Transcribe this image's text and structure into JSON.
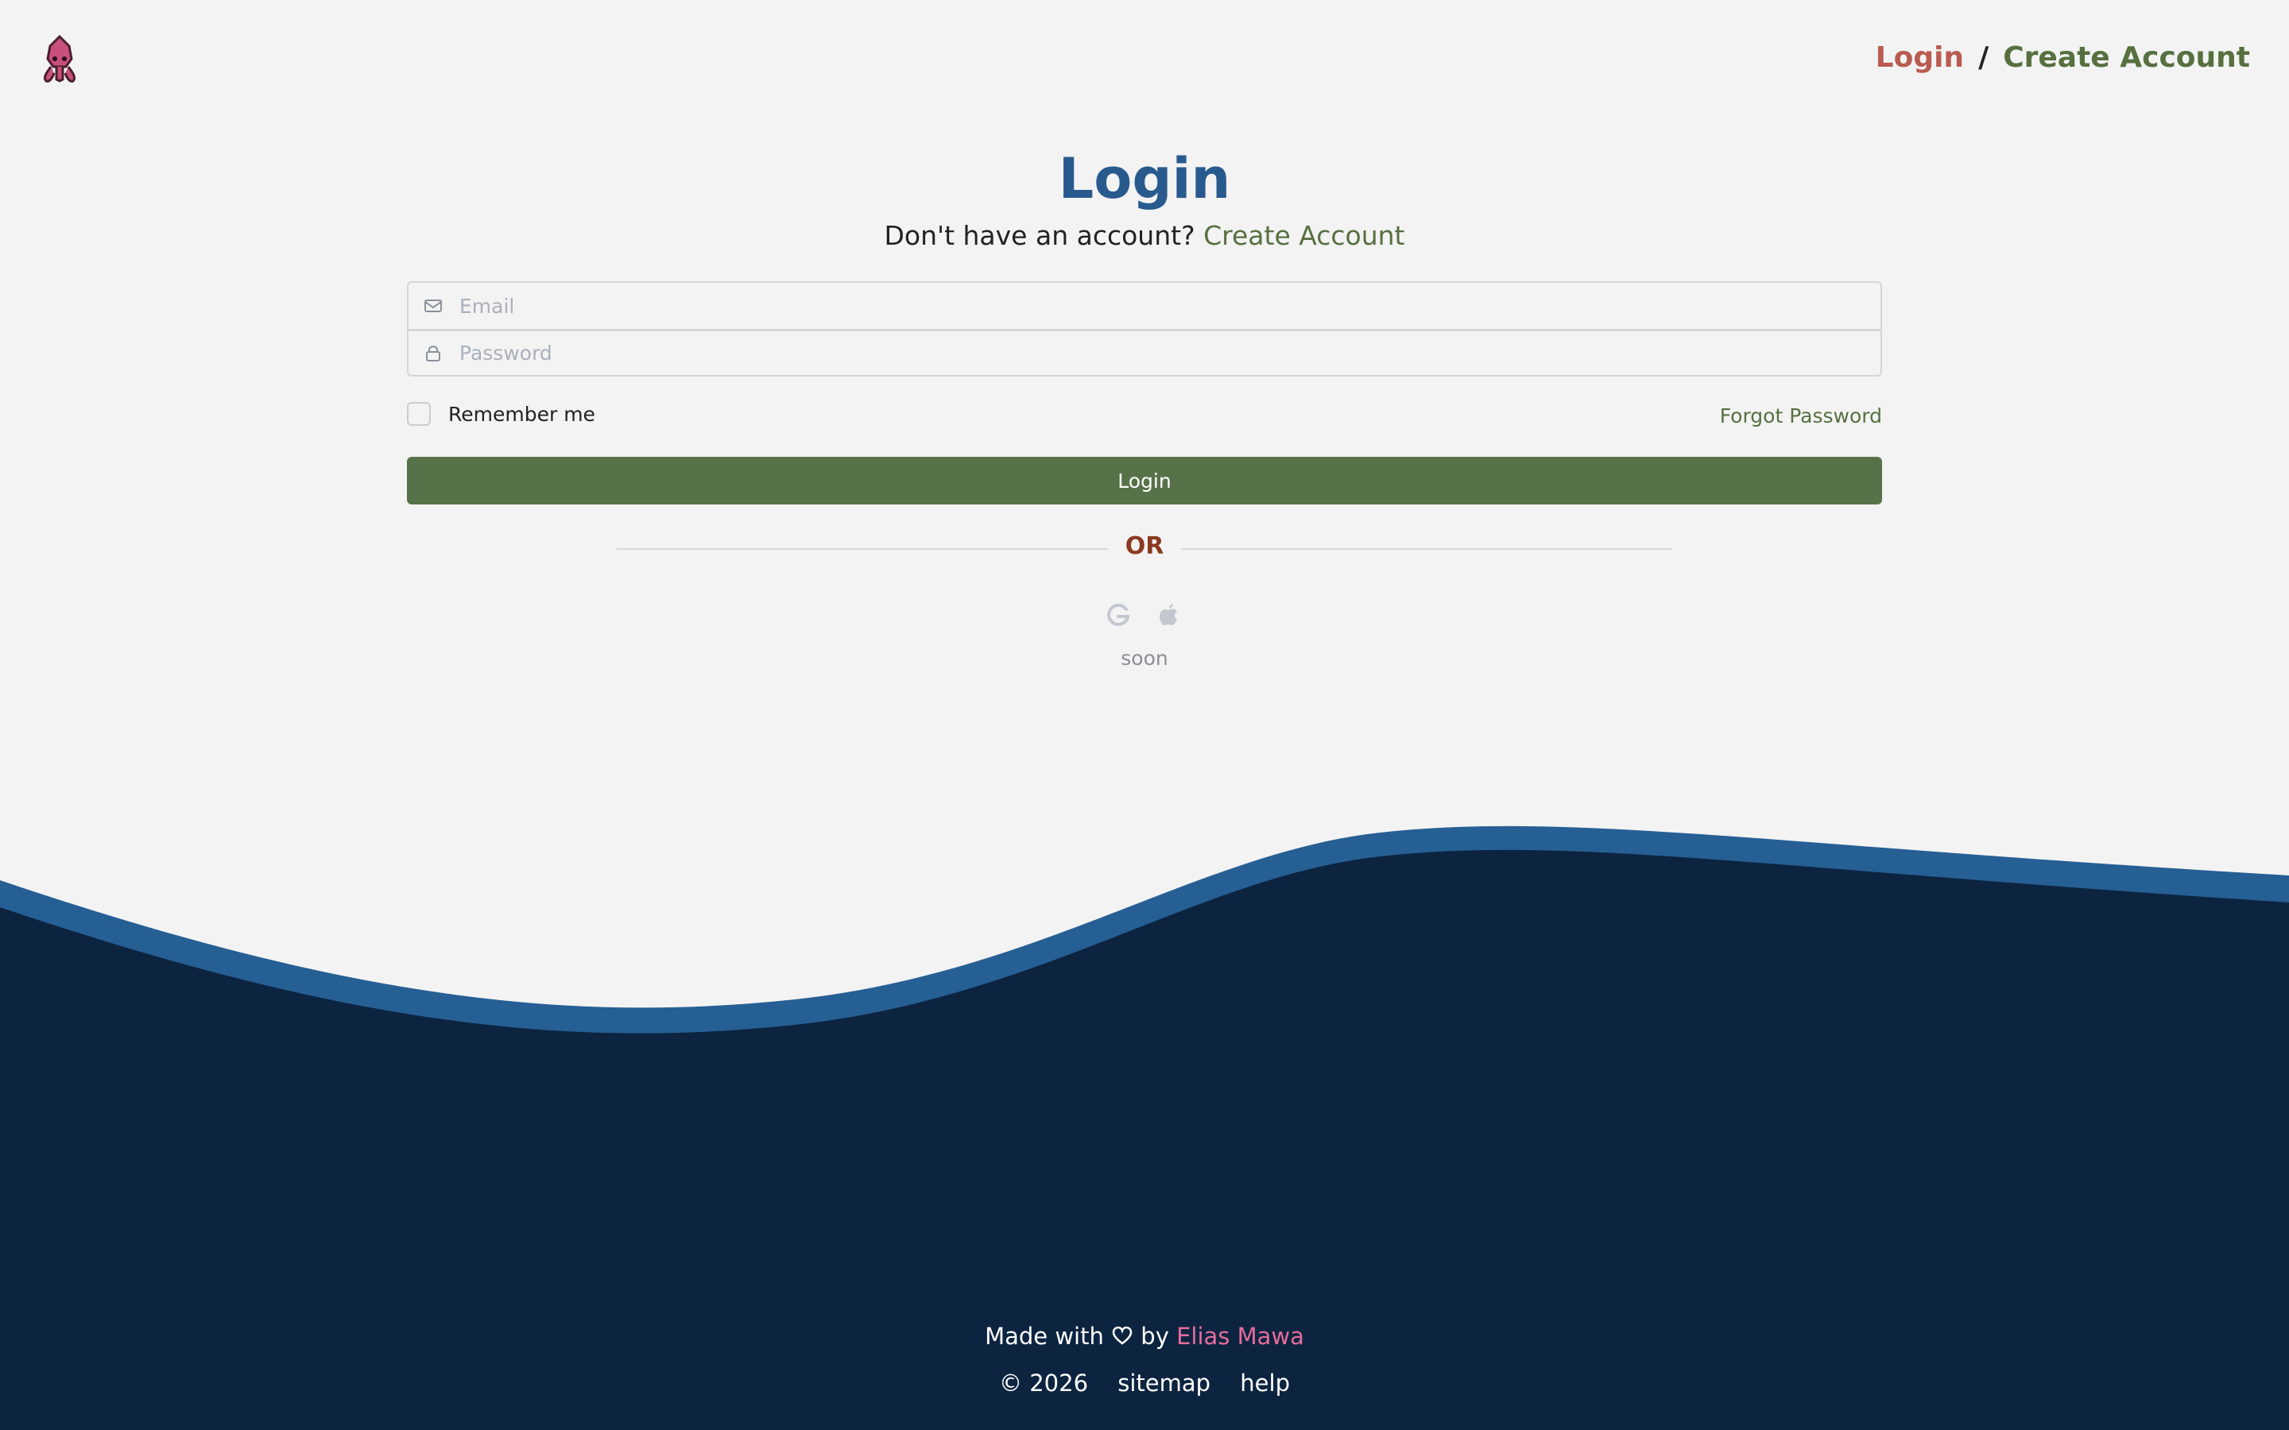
{
  "header": {
    "nav_login": "Login",
    "nav_separator": "/",
    "nav_create": "Create Account"
  },
  "main": {
    "title": "Login",
    "subtitle_prefix": "Don't have an account?",
    "subtitle_link": "Create Account",
    "email_placeholder": "Email",
    "password_placeholder": "Password",
    "remember_label": "Remember me",
    "forgot_label": "Forgot Password",
    "login_button": "Login",
    "divider": "OR",
    "social_note": "soon"
  },
  "footer": {
    "made_with": "Made with",
    "by": "by",
    "author": "Elias Mawa",
    "copyright": "© 2026",
    "sitemap": "sitemap",
    "help": "help"
  },
  "colors": {
    "background": "#f3f3f3",
    "title_blue": "#285a8e",
    "accent_green": "#577248",
    "nav_login_red": "#b95c4f",
    "divider_brown": "#8b3a1f",
    "footer_navy": "#0c2440",
    "wave_blue": "#265f94",
    "author_pink": "#e56b9b"
  },
  "icons": [
    "squid-logo-icon",
    "mail-icon",
    "lock-icon",
    "google-icon",
    "apple-icon",
    "heart-icon"
  ]
}
